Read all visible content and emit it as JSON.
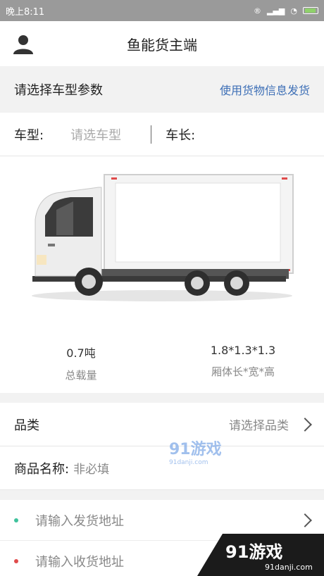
{
  "status": {
    "time": "晚上8:11"
  },
  "header": {
    "title": "鱼能货主端"
  },
  "section": {
    "title": "请选择车型参数",
    "link": "使用货物信息发货"
  },
  "vehicle": {
    "type_label": "车型:",
    "type_placeholder": "请选车型",
    "length_label": "车长:"
  },
  "truck": {
    "capacity_value": "0.7吨",
    "capacity_caption": "总载量",
    "dims_value": "1.8*1.3*1.3",
    "dims_caption": "厢体长*宽*高"
  },
  "form": {
    "category_label": "品类",
    "category_value": "请选择品类",
    "goods_label": "商品名称:",
    "goods_value": "非必填",
    "ship_from_placeholder": "请输入发货地址",
    "ship_to_placeholder": "请输入收货地址"
  },
  "colors": {
    "accent_link": "#3d6fb6",
    "from_dot": "#3fc29c",
    "to_dot": "#e04b4b"
  },
  "watermark": {
    "left_top": "91游戏",
    "left_sub": "91danji.com",
    "right_top": "91游戏",
    "right_sub": "91danji.com"
  }
}
